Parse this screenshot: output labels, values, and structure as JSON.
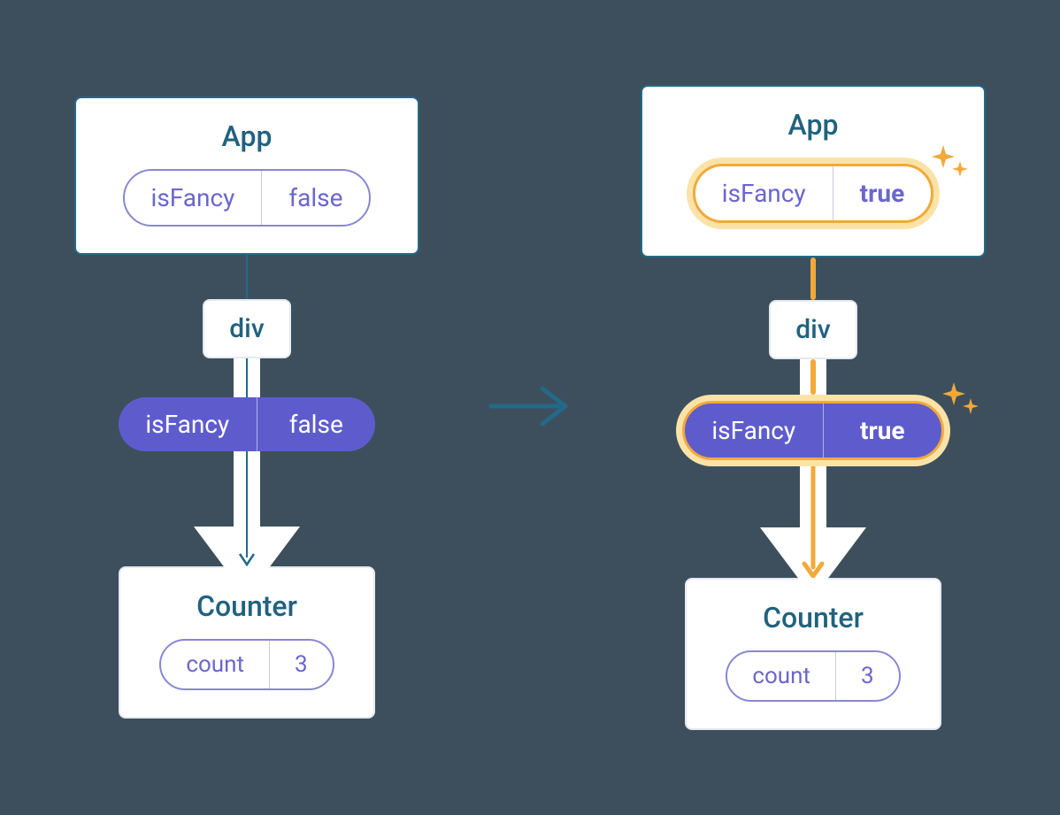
{
  "left": {
    "app": {
      "title": "App",
      "state": {
        "key": "isFancy",
        "value": "false"
      }
    },
    "div": {
      "label": "div"
    },
    "prop": {
      "key": "isFancy",
      "value": "false"
    },
    "counter": {
      "title": "Counter",
      "state": {
        "key": "count",
        "value": "3"
      }
    }
  },
  "right": {
    "app": {
      "title": "App",
      "state": {
        "key": "isFancy",
        "value": "true"
      }
    },
    "div": {
      "label": "div"
    },
    "prop": {
      "key": "isFancy",
      "value": "true"
    },
    "counter": {
      "title": "Counter",
      "state": {
        "key": "count",
        "value": "3"
      }
    }
  },
  "colors": {
    "teal": "#20627f",
    "purple": "#5e5ccd",
    "purpleText": "#6b66cf",
    "highlight": "#f2a93a",
    "highlightBg": "#fbe3a8",
    "bg": "#3d4f5c"
  }
}
